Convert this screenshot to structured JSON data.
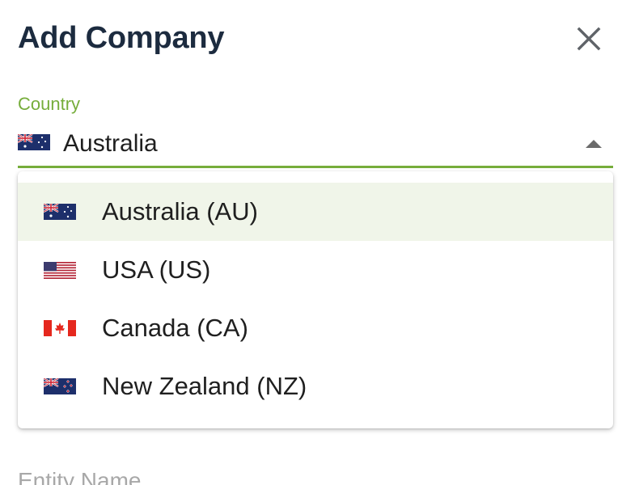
{
  "dialog": {
    "title": "Add Company",
    "close_icon": "close-icon"
  },
  "country_field": {
    "label": "Country",
    "selected_value": "Australia",
    "selected_flag_icon": "flag-au-icon",
    "dropdown_icon": "caret-up-icon",
    "options": [
      {
        "label": "Australia (AU)",
        "flag_icon": "flag-au-icon",
        "selected": true
      },
      {
        "label": "USA (US)",
        "flag_icon": "flag-us-icon",
        "selected": false
      },
      {
        "label": "Canada (CA)",
        "flag_icon": "flag-ca-icon",
        "selected": false
      },
      {
        "label": "New Zealand (NZ)",
        "flag_icon": "flag-nz-icon",
        "selected": false
      }
    ]
  },
  "entity_name_field": {
    "label": "Entity Name"
  },
  "colors": {
    "accent": "#76ad3b",
    "title": "#1c2b3f",
    "selected_option_bg": "#f0f5e9",
    "muted_label": "#a8a8a8"
  }
}
